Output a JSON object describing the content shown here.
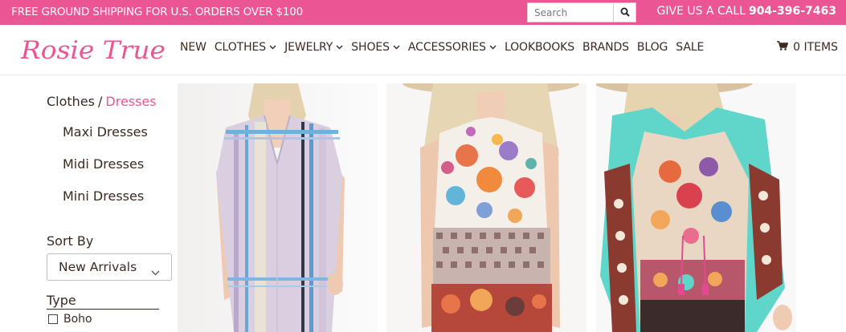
{
  "topbar": {
    "promo": "FREE GROUND SHIPPING FOR U.S. ORDERS OVER $100",
    "search_placeholder": "Search",
    "call_text": "GIVE US A CALL",
    "phone": "904-396-7463"
  },
  "header": {
    "logo_text": "Rosie True",
    "nav": [
      {
        "label": "NEW",
        "dropdown": false
      },
      {
        "label": "CLOTHES",
        "dropdown": true
      },
      {
        "label": "JEWELRY",
        "dropdown": true
      },
      {
        "label": "SHOES",
        "dropdown": true
      },
      {
        "label": "ACCESSORIES",
        "dropdown": true
      },
      {
        "label": "LOOKBOOKS",
        "dropdown": false
      },
      {
        "label": "BRANDS",
        "dropdown": false
      },
      {
        "label": "BLOG",
        "dropdown": false
      },
      {
        "label": "SALE",
        "dropdown": false
      }
    ],
    "cart_label": "0 ITEMS"
  },
  "sidebar": {
    "breadcrumb": {
      "parent": "Clothes",
      "separator": "/",
      "current": "Dresses"
    },
    "subcategories": [
      "Maxi Dresses",
      "Midi Dresses",
      "Mini Dresses"
    ],
    "sort_label": "Sort By",
    "sort_value": "New Arrivals",
    "type_label": "Type",
    "type_options": [
      "Boho"
    ]
  },
  "colors": {
    "brand_pink": "#ec5593",
    "text_brown": "#3b2a22"
  },
  "products": [
    {
      "name": "striped-tunic-dress",
      "main_color": "#c9b8d8"
    },
    {
      "name": "floral-print-dress",
      "main_color": "#e8744a"
    },
    {
      "name": "paisley-kaftan-dress",
      "main_color": "#5fd6c9"
    }
  ]
}
